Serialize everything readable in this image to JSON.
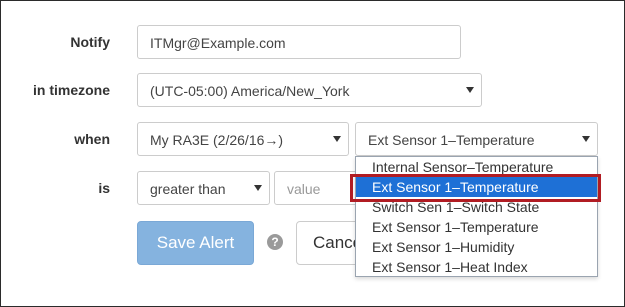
{
  "form": {
    "notify": {
      "label": "Notify",
      "value": "ITMgr@Example.com"
    },
    "timezone": {
      "label": "in timezone",
      "value": "(UTC-05:00) America/New_York"
    },
    "when": {
      "label": "when",
      "device_value": "My RA3E (2/26/16→)",
      "sensor_value": "Ext Sensor 1–Temperature"
    },
    "is": {
      "label": "is",
      "comparison_value": "greater than",
      "value_placeholder": "value"
    },
    "buttons": {
      "save_label": "Save Alert",
      "help_icon": "?",
      "cancel_label": "Cancel"
    }
  },
  "sensor_dropdown": {
    "options": [
      "Internal Sensor–Temperature",
      "Ext Sensor 1–Temperature",
      "Switch Sen 1–Switch State",
      "Ext Sensor 1–Temperature",
      "Ext Sensor 1–Humidity",
      "Ext Sensor 1–Heat Index"
    ],
    "selected_index": 1
  },
  "colors": {
    "primary_button": "#85b3df",
    "selected_option": "#1e70d6",
    "annotation_box": "#b11c23"
  }
}
